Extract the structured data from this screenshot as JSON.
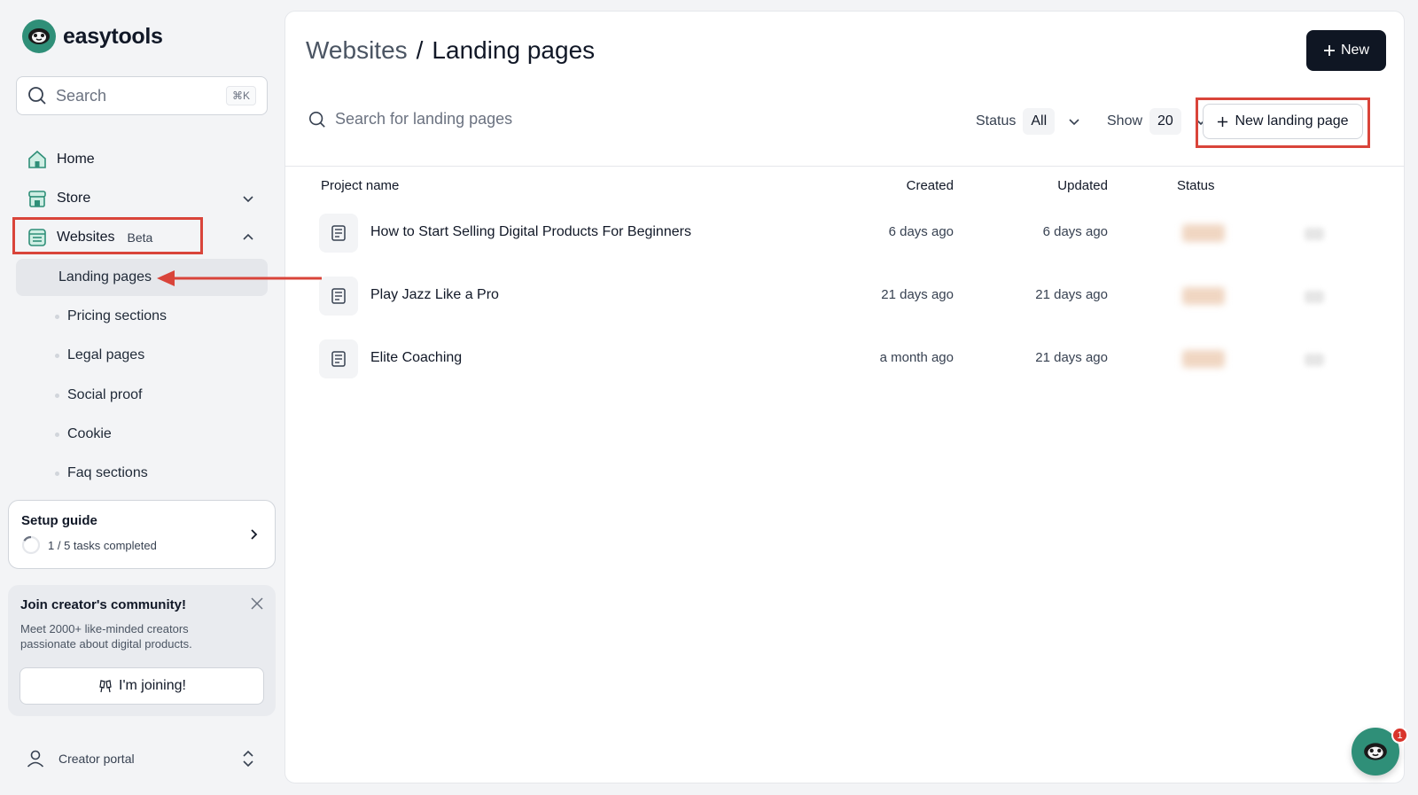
{
  "app": {
    "name": "easytools"
  },
  "sidebar": {
    "search": {
      "placeholder": "Search",
      "shortcut": "⌘K"
    },
    "nav": [
      {
        "label": "Home",
        "icon": "home-icon"
      },
      {
        "label": "Store",
        "icon": "store-icon"
      },
      {
        "label": "Websites",
        "badge": "Beta",
        "icon": "website-icon"
      }
    ],
    "sub": [
      "Landing pages",
      "Pricing sections",
      "Legal pages",
      "Social proof",
      "Cookie",
      "Faq sections"
    ],
    "setup": {
      "title": "Setup guide",
      "progress": "1 / 5 tasks completed",
      "completed": 1,
      "total": 5
    },
    "community": {
      "title": "Join creator's community!",
      "text": "Meet 2000+ like-minded creators passionate about digital products.",
      "button": "I'm joining!"
    },
    "portal": {
      "label": "Creator portal"
    }
  },
  "main": {
    "breadcrumb": {
      "parent": "Websites",
      "separator": "/",
      "current": "Landing pages"
    },
    "new_button": "New",
    "search_placeholder": "Search for landing pages",
    "status_filter": {
      "label": "Status",
      "value": "All"
    },
    "show_filter": {
      "label": "Show",
      "value": "20"
    },
    "new_landing_button": "New landing page",
    "columns": [
      "Project name",
      "Created",
      "Updated",
      "Status"
    ],
    "rows": [
      {
        "title": "How to Start Selling Digital Products For Beginners",
        "created": "6 days ago",
        "updated": "6 days ago"
      },
      {
        "title": "Play Jazz Like a Pro",
        "created": "21 days ago",
        "updated": "21 days ago"
      },
      {
        "title": "Elite Coaching",
        "created": "a month ago",
        "updated": "21 days ago"
      }
    ]
  },
  "chat": {
    "badge": "1"
  },
  "colors": {
    "brand": "#2f8f78",
    "annotation": "#d9443a",
    "primary_button": "#0f1623"
  }
}
